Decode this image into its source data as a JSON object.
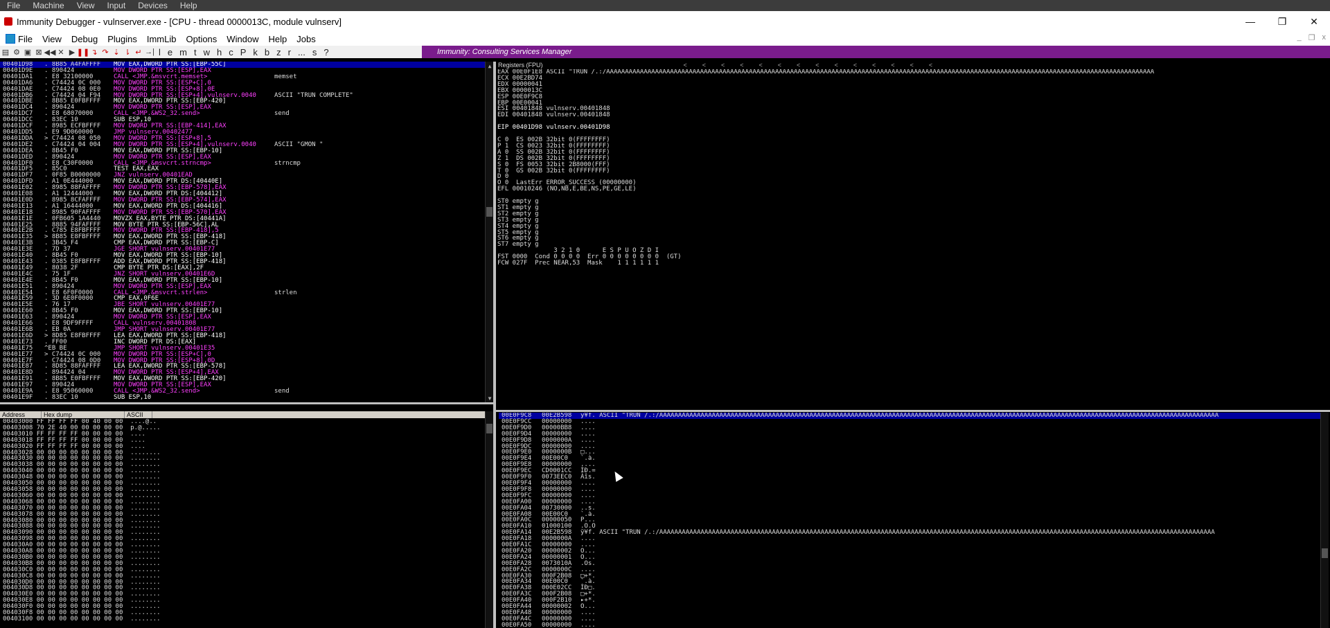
{
  "host_menu": [
    "File",
    "Machine",
    "View",
    "Input",
    "Devices",
    "Help"
  ],
  "window": {
    "title": "Immunity Debugger - vulnserver.exe - [CPU - thread 0000013C, module vulnserv]",
    "min": "—",
    "max": "❐",
    "close": "✕"
  },
  "menu": [
    "File",
    "View",
    "Debug",
    "Plugins",
    "ImmLib",
    "Options",
    "Window",
    "Help",
    "Jobs"
  ],
  "toolbar": {
    "letters": [
      "l",
      "e",
      "m",
      "t",
      "w",
      "h",
      "c",
      "P",
      "k",
      "b",
      "z",
      "r",
      "...",
      "s",
      "?"
    ],
    "banner": "Immunity: Consulting Services Manager"
  },
  "registers_title": "Registers (FPU)",
  "cpu_rows": [
    {
      "a": "00401D98",
      "h": ". 8B85 A4FAFFFF",
      "i": "MOV EAX,DWORD PTR SS:[EBP-55C]",
      "c": "",
      "sel": true
    },
    {
      "a": "00401D9E",
      "h": ". 890424",
      "i": "MOV DWORD PTR SS:[ESP],EAX",
      "c": ""
    },
    {
      "a": "00401DA1",
      "h": ". E8 32100000",
      "i": "CALL <JMP.&msvcrt.memset>",
      "c": "memset"
    },
    {
      "a": "00401DA6",
      "h": ". C74424 0C 000",
      "i": "MOV DWORD PTR SS:[ESP+C],0",
      "c": ""
    },
    {
      "a": "00401DAE",
      "h": ". C74424 08 0E0",
      "i": "MOV DWORD PTR SS:[ESP+8],0E",
      "c": ""
    },
    {
      "a": "00401DB6",
      "h": ". C74424 04 F94",
      "i": "MOV DWORD PTR SS:[ESP+4],vulnserv.0040",
      "c": "ASCII \"TRUN COMPLETE\""
    },
    {
      "a": "00401DBE",
      "h": ". 8B85 E0FBFFFF",
      "i": "MOV EAX,DWORD PTR SS:[EBP-420]",
      "c": ""
    },
    {
      "a": "00401DC4",
      "h": ". 890424",
      "i": "MOV DWORD PTR SS:[ESP],EAX",
      "c": ""
    },
    {
      "a": "00401DC7",
      "h": ". E8 68070000",
      "i": "CALL <JMP.&WS2_32.send>",
      "c": "send"
    },
    {
      "a": "00401DCC",
      "h": ". 83EC 10",
      "i": "SUB ESP,10",
      "c": ""
    },
    {
      "a": "00401DCF",
      "h": ". 8985 ECFBFFFF",
      "i": "MOV DWORD PTR SS:[EBP-414],EAX",
      "c": ""
    },
    {
      "a": "00401DD5",
      "h": ". E9 9D060000",
      "i": "JMP vulnserv.00402477",
      "c": ""
    },
    {
      "a": "00401DDA",
      "h": "> C74424 08 050",
      "i": "MOV DWORD PTR SS:[ESP+8],5",
      "c": ""
    },
    {
      "a": "00401DE2",
      "h": ". C74424 04 004",
      "i": "MOV DWORD PTR SS:[ESP+4],vulnserv.0040",
      "c": "ASCII \"GMON \""
    },
    {
      "a": "00401DEA",
      "h": ". 8B45 F0",
      "i": "MOV EAX,DWORD PTR SS:[EBP-10]",
      "c": ""
    },
    {
      "a": "00401DED",
      "h": ". 890424",
      "i": "MOV DWORD PTR SS:[ESP],EAX",
      "c": ""
    },
    {
      "a": "00401DF0",
      "h": ". E8 C30F0000",
      "i": "CALL <JMP.&msvcrt.strncmp>",
      "c": "strncmp"
    },
    {
      "a": "00401DF5",
      "h": ". 85C0",
      "i": "TEST EAX,EAX",
      "c": ""
    },
    {
      "a": "00401DF7",
      "h": ". 0F85 B0000000",
      "i": "JNZ vulnserv.00401EAD",
      "c": ""
    },
    {
      "a": "00401DFD",
      "h": ". A1 0E444000",
      "i": "MOV EAX,DWORD PTR DS:[40440E]",
      "c": ""
    },
    {
      "a": "00401E02",
      "h": ". 8985 88FAFFFF",
      "i": "MOV DWORD PTR SS:[EBP-578],EAX",
      "c": ""
    },
    {
      "a": "00401E08",
      "h": ". A1 12444000",
      "i": "MOV EAX,DWORD PTR DS:[404412]",
      "c": ""
    },
    {
      "a": "00401E0D",
      "h": ". 8985 8CFAFFFF",
      "i": "MOV DWORD PTR SS:[EBP-574],EAX",
      "c": ""
    },
    {
      "a": "00401E13",
      "h": ". A1 16444000",
      "i": "MOV EAX,DWORD PTR DS:[404416]",
      "c": ""
    },
    {
      "a": "00401E18",
      "h": ". 8985 90FAFFFF",
      "i": "MOV DWORD PTR SS:[EBP-570],EAX",
      "c": ""
    },
    {
      "a": "00401E1E",
      "h": ". 0FB605 1A4440",
      "i": "MOVZX EAX,BYTE PTR DS:[40441A]",
      "c": ""
    },
    {
      "a": "00401E25",
      "h": ". 8885 94FAFFFF",
      "i": "MOV BYTE PTR SS:[EBP-56C],AL",
      "c": ""
    },
    {
      "a": "00401E2B",
      "h": ". C785 E8FBFFFF",
      "i": "MOV DWORD PTR SS:[EBP-418],5",
      "c": ""
    },
    {
      "a": "00401E35",
      "h": "> 8B85 E8FBFFFF",
      "i": "MOV EAX,DWORD PTR SS:[EBP-418]",
      "c": ""
    },
    {
      "a": "00401E3B",
      "h": ". 3B45 F4",
      "i": "CMP EAX,DWORD PTR SS:[EBP-C]",
      "c": ""
    },
    {
      "a": "00401E3E",
      "h": ". 7D 37",
      "i": "JGE SHORT vulnserv.00401E77",
      "c": ""
    },
    {
      "a": "00401E40",
      "h": ". 8B45 F0",
      "i": "MOV EAX,DWORD PTR SS:[EBP-10]",
      "c": ""
    },
    {
      "a": "00401E43",
      "h": ". 0385 E8FBFFFF",
      "i": "ADD EAX,DWORD PTR SS:[EBP-418]",
      "c": ""
    },
    {
      "a": "00401E49",
      "h": ". 8038 2F",
      "i": "CMP BYTE PTR DS:[EAX],2F",
      "c": ""
    },
    {
      "a": "00401E4C",
      "h": ". 75 1F",
      "i": "JNZ SHORT vulnserv.00401E6D",
      "c": ""
    },
    {
      "a": "00401E4E",
      "h": ". 8B45 F0",
      "i": "MOV EAX,DWORD PTR SS:[EBP-10]",
      "c": ""
    },
    {
      "a": "00401E51",
      "h": ". 890424",
      "i": "MOV DWORD PTR SS:[ESP],EAX",
      "c": ""
    },
    {
      "a": "00401E54",
      "h": ". E8 6F0F0000",
      "i": "CALL <JMP.&msvcrt.strlen>",
      "c": "strlen"
    },
    {
      "a": "00401E59",
      "h": ". 3D 6E0F0000",
      "i": "CMP EAX,0F6E",
      "c": ""
    },
    {
      "a": "00401E5E",
      "h": ". 76 17",
      "i": "JBE SHORT vulnserv.00401E77",
      "c": ""
    },
    {
      "a": "00401E60",
      "h": ". 8B45 F0",
      "i": "MOV EAX,DWORD PTR SS:[EBP-10]",
      "c": ""
    },
    {
      "a": "00401E63",
      "h": ". 890424",
      "i": "MOV DWORD PTR SS:[ESP],EAX",
      "c": ""
    },
    {
      "a": "00401E66",
      "h": ". E8 9DF9FFFF",
      "i": "CALL vulnserv.00401808",
      "c": ""
    },
    {
      "a": "00401E6B",
      "h": ". EB 0A",
      "i": "JMP SHORT vulnserv.00401E77",
      "c": ""
    },
    {
      "a": "00401E6D",
      "h": "> 8D85 E8FBFFFF",
      "i": "LEA EAX,DWORD PTR SS:[EBP-418]",
      "c": ""
    },
    {
      "a": "00401E73",
      "h": ". FF00",
      "i": "INC DWORD PTR DS:[EAX]",
      "c": ""
    },
    {
      "a": "00401E75",
      "h": "^EB BE",
      "i": "JMP SHORT vulnserv.00401E35",
      "c": ""
    },
    {
      "a": "00401E77",
      "h": "> C74424 0C 000",
      "i": "MOV DWORD PTR SS:[ESP+C],0",
      "c": ""
    },
    {
      "a": "00401E7F",
      "h": ". C74424 08 0D0",
      "i": "MOV DWORD PTR SS:[ESP+8],0D",
      "c": ""
    },
    {
      "a": "00401E87",
      "h": ". 8D85 88FAFFFF",
      "i": "LEA EAX,DWORD PTR SS:[EBP-578]",
      "c": ""
    },
    {
      "a": "00401E8D",
      "h": ". 894424 04",
      "i": "MOV DWORD PTR SS:[ESP+4],EAX",
      "c": ""
    },
    {
      "a": "00401E91",
      "h": ". 8B85 E0FBFFFF",
      "i": "MOV EAX,DWORD PTR SS:[EBP-420]",
      "c": ""
    },
    {
      "a": "00401E97",
      "h": ". 890424",
      "i": "MOV DWORD PTR SS:[ESP],EAX",
      "c": ""
    },
    {
      "a": "00401E9A",
      "h": ". E8 95060000",
      "i": "CALL <JMP.&WS2_32.send>",
      "c": "send"
    },
    {
      "a": "00401E9F",
      "h": ". 83EC 10",
      "i": "SUB ESP,10",
      "c": ""
    }
  ],
  "registers": [
    "EAX 00E0F1E8 ASCII \"TRUN /.:/AAAAAAAAAAAAAAAAAAAAAAAAAAAAAAAAAAAAAAAAAAAAAAAAAAAAAAAAAAAAAAAAAAAAAAAAAAAAAAAAAAAAAAAAAAAAAAAAAAAAAAAAAAAAAAAAAAAAAAAAAAAAAAAAAAAAAAAAAAAAAAAAAA",
    "ECX 00E2BD74",
    "EDX 00000041",
    "EBX 0000013C",
    "ESP 00E0F9C8",
    "EBP 00E00041",
    "ESI 00401848 vulnserv.00401848",
    "EDI 00401848 vulnserv.00401848",
    "",
    "EIP 00401D98 vulnserv.00401D98",
    "",
    "C 0  ES 002B 32bit 0(FFFFFFFF)",
    "P 1  CS 0023 32bit 0(FFFFFFFF)",
    "A 0  SS 002B 32bit 0(FFFFFFFF)",
    "Z 1  DS 002B 32bit 0(FFFFFFFF)",
    "S 0  FS 0053 32bit 2B8000(FFF)",
    "T 0  GS 002B 32bit 0(FFFFFFFF)",
    "D 0",
    "O 0  LastErr ERROR_SUCCESS (00000000)",
    "EFL 00010246 (NO,NB,E,BE,NS,PE,GE,LE)",
    "",
    "ST0 empty g",
    "ST1 empty g",
    "ST2 empty g",
    "ST3 empty g",
    "ST4 empty g",
    "ST5 empty g",
    "ST6 empty g",
    "ST7 empty g",
    "               3 2 1 0      E S P U O Z D I",
    "FST 0000  Cond 0 0 0 0  Err 0 0 0 0 0 0 0 0  (GT)",
    "FCW 027F  Prec NEAR,53  Mask    1 1 1 1 1 1"
  ],
  "dump_headers": [
    "Address",
    "Hex dump",
    "ASCII"
  ],
  "dump_rows": [
    "00403000 FF FF FF FF 00 40 00 00  ....@..",
    "00403008 70 2E 40 00 00 00 00 00  p.@.....",
    "00403010 FF FF FF FF 00 00 00 00  ....",
    "00403018 FF FF FF FF 00 00 00 00  ....",
    "00403020 FF FF FF FF 00 00 00 00  ....",
    "00403028 00 00 00 00 00 00 00 00  ........",
    "00403030 00 00 00 00 00 00 00 00  ........",
    "00403038 00 00 00 00 00 00 00 00  ........",
    "00403040 00 00 00 00 00 00 00 00  ........",
    "00403048 00 00 00 00 00 00 00 00  ........",
    "00403050 00 00 00 00 00 00 00 00  ........",
    "00403058 00 00 00 00 00 00 00 00  ........",
    "00403060 00 00 00 00 00 00 00 00  ........",
    "00403068 00 00 00 00 00 00 00 00  ........",
    "00403070 00 00 00 00 00 00 00 00  ........",
    "00403078 00 00 00 00 00 00 00 00  ........",
    "00403080 00 00 00 00 00 00 00 00  ........",
    "00403088 00 00 00 00 00 00 00 00  ........",
    "00403090 00 00 00 00 00 00 00 00  ........",
    "00403098 00 00 00 00 00 00 00 00  ........",
    "004030A0 00 00 00 00 00 00 00 00  ........",
    "004030A8 00 00 00 00 00 00 00 00  ........",
    "004030B0 00 00 00 00 00 00 00 00  ........",
    "004030B8 00 00 00 00 00 00 00 00  ........",
    "004030C0 00 00 00 00 00 00 00 00  ........",
    "004030C8 00 00 00 00 00 00 00 00  ........",
    "004030D0 00 00 00 00 00 00 00 00  ........",
    "004030D8 00 00 00 00 00 00 00 00  ........",
    "004030E0 00 00 00 00 00 00 00 00  ........",
    "004030E8 00 00 00 00 00 00 00 00  ........",
    "004030F0 00 00 00 00 00 00 00 00  ........",
    "004030F8 00 00 00 00 00 00 00 00  ........",
    "00403100 00 00 00 00 00 00 00 00  ........"
  ],
  "stack_rows": [
    {
      "a": "00E0F9C8",
      "v": "00E2B598",
      "t": "ÿ¥f. ASCII \"TRUN /.:/AAAAAAAAAAAAAAAAAAAAAAAAAAAAAAAAAAAAAAAAAAAAAAAAAAAAAAAAAAAAAAAAAAAAAAAAAAAAAAAAAAAAAAAAAAAAAAAAAAAAAAAAAAAAAAAAAAAAAAAAAAAAAAAAAAAAAAAAAAAAAAAAAAAAA",
      "sel": true
    },
    {
      "a": "00E0F9CC",
      "v": "00000000",
      "t": "...."
    },
    {
      "a": "00E0F9D0",
      "v": "00000BB8",
      "t": "...."
    },
    {
      "a": "00E0F9D4",
      "v": "00000000",
      "t": "...."
    },
    {
      "a": "00E0F9D8",
      "v": "0000000A",
      "t": "...."
    },
    {
      "a": "00E0F9DC",
      "v": "00000000",
      "t": "...."
    },
    {
      "a": "00E0F9E0",
      "v": "0000000B",
      "t": "□..."
    },
    {
      "a": "00E0F9E4",
      "v": "00E00C0",
      "t": "`.à."
    },
    {
      "a": "00E0F9E8",
      "v": "00000000",
      "t": "...."
    },
    {
      "a": "00E0F9EC",
      "v": "CD0001CC",
      "t": "ÌÐ.="
    },
    {
      "a": "00E0F9F0",
      "v": "0073EEC0",
      "t": "Àîs."
    },
    {
      "a": "00E0F9F4",
      "v": "00000000",
      "t": "...."
    },
    {
      "a": "00E0F9F8",
      "v": "00000000",
      "t": "...."
    },
    {
      "a": "00E0F9FC",
      "v": "00000000",
      "t": "...."
    },
    {
      "a": "00E0FA00",
      "v": "00000000",
      "t": "...."
    },
    {
      "a": "00E0FA04",
      "v": "00730000",
      "t": "..s."
    },
    {
      "a": "00E0FA08",
      "v": "00E00C0",
      "t": "`.à."
    },
    {
      "a": "00E0FA0C",
      "v": "00000050",
      "t": "P..."
    },
    {
      "a": "00E0FA10",
      "v": "01000100",
      "t": ".O.O"
    },
    {
      "a": "00E0FA14",
      "v": "00E2B598",
      "t": "ÿ¥f. ASCII \"TRUN /.:/AAAAAAAAAAAAAAAAAAAAAAAAAAAAAAAAAAAAAAAAAAAAAAAAAAAAAAAAAAAAAAAAAAAAAAAAAAAAAAAAAAAAAAAAAAAAAAAAAAAAAAAAAAAAAAAAAAAAAAAAAAAAAAAAAAAAAAAAAAAAAAAAAAAA"
    },
    {
      "a": "00E0FA18",
      "v": "0000000A",
      "t": "...."
    },
    {
      "a": "00E0FA1C",
      "v": "00000000",
      "t": "...."
    },
    {
      "a": "00E0FA20",
      "v": "00000002",
      "t": "O..."
    },
    {
      "a": "00E0FA24",
      "v": "00000001",
      "t": "O..."
    },
    {
      "a": "00E0FA28",
      "v": "0073010A",
      "t": ".Os."
    },
    {
      "a": "00E0FA2C",
      "v": "0000000C",
      "t": "...."
    },
    {
      "a": "00E0FA30",
      "v": "000F2B08",
      "t": "□+*."
    },
    {
      "a": "00E0FA34",
      "v": "00E00C0",
      "t": "`.à."
    },
    {
      "a": "00E0FA38",
      "v": "000E02CC",
      "t": "ÌÐ□."
    },
    {
      "a": "00E0FA3C",
      "v": "000F2B08",
      "t": "□+*."
    },
    {
      "a": "00E0FA40",
      "v": "000F2B10",
      "t": "▸+*."
    },
    {
      "a": "00E0FA44",
      "v": "00000002",
      "t": "O..."
    },
    {
      "a": "00E0FA48",
      "v": "00000000",
      "t": "...."
    },
    {
      "a": "00E0FA4C",
      "v": "00000000",
      "t": "...."
    },
    {
      "a": "00E0FA50",
      "v": "00000000",
      "t": "...."
    }
  ]
}
